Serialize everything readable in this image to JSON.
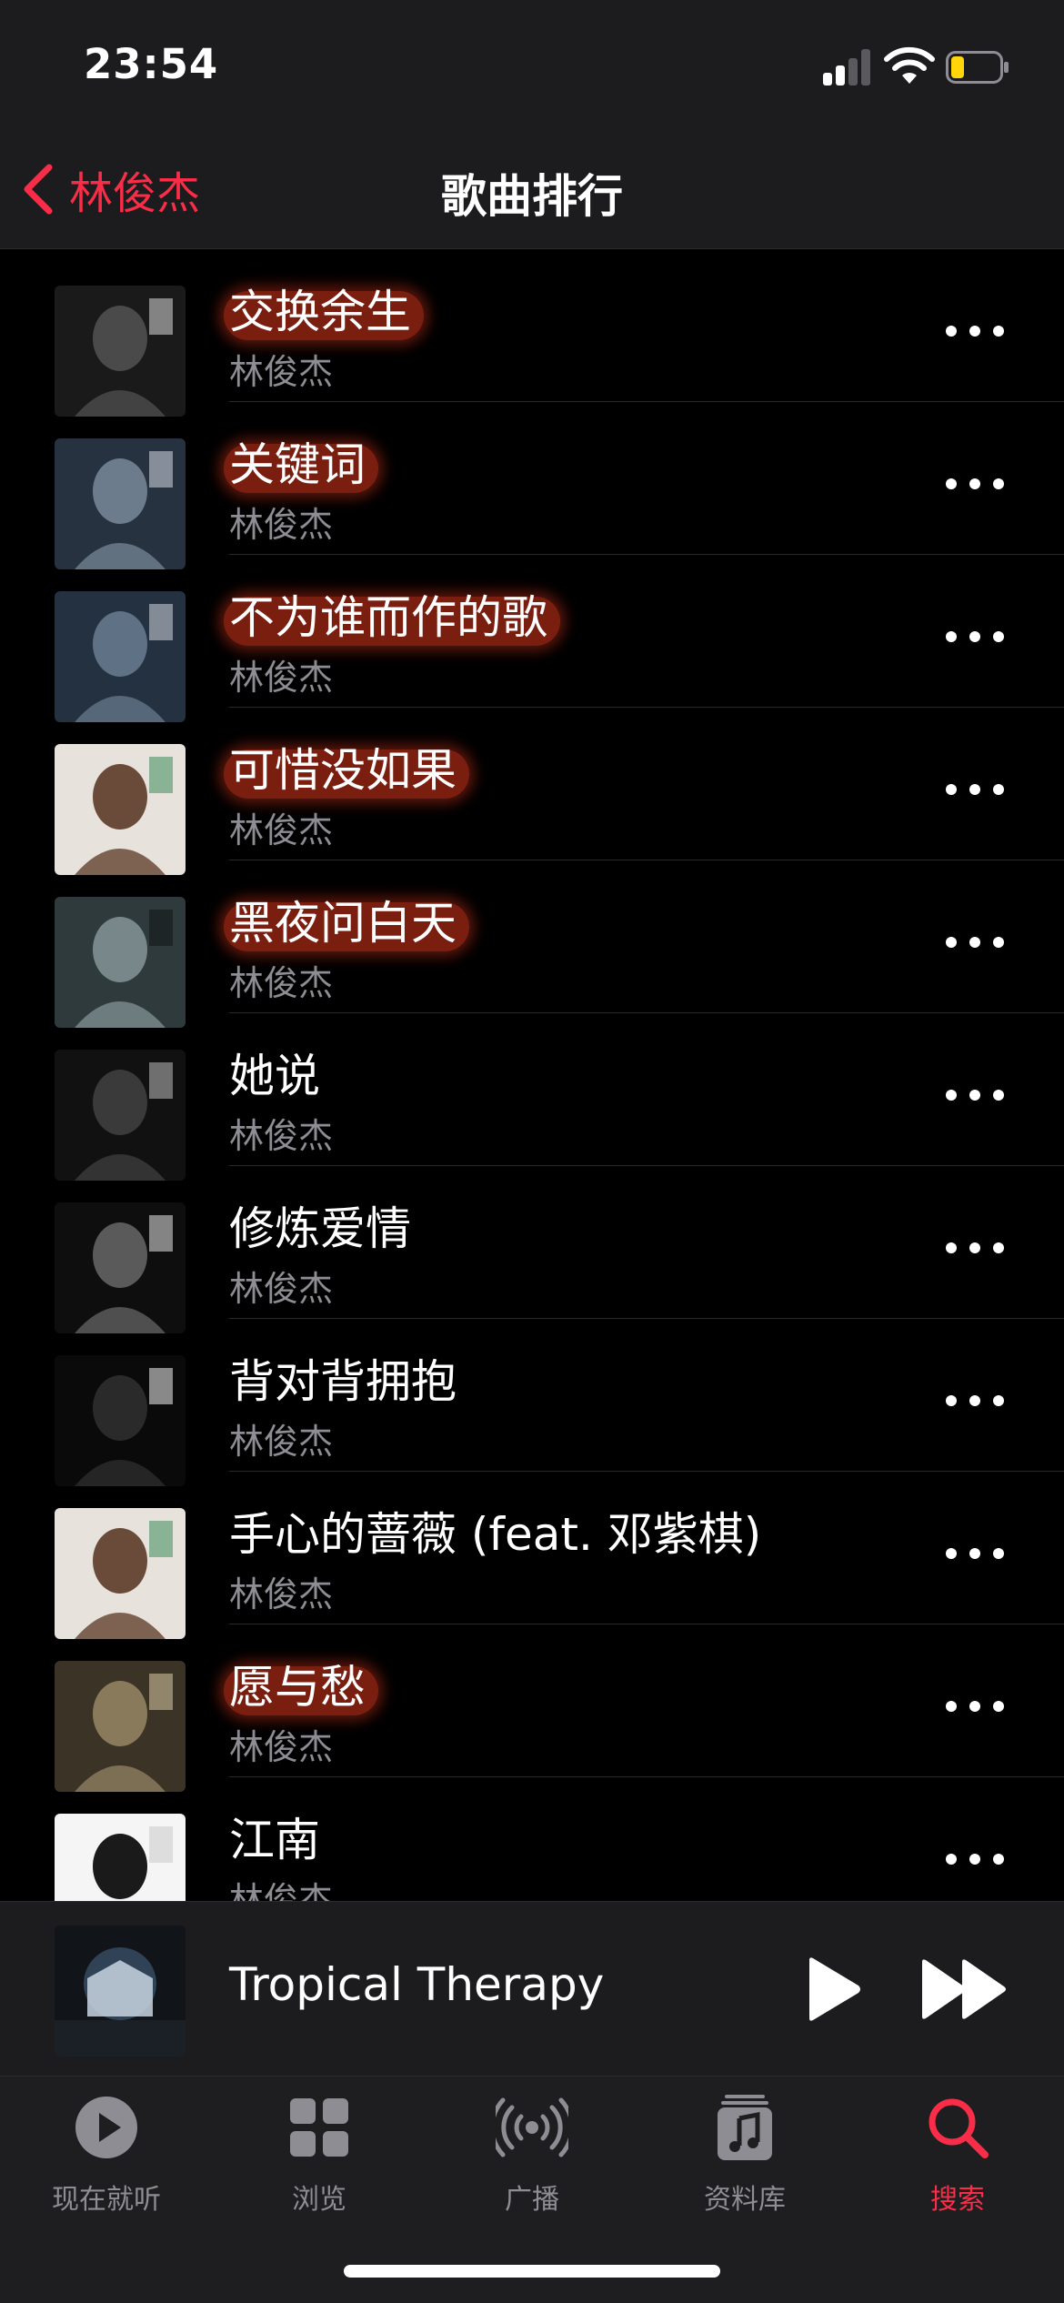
{
  "status_bar": {
    "time": "23:54"
  },
  "nav": {
    "back_label": "林俊杰",
    "title": "歌曲排行"
  },
  "songs": [
    {
      "title": "交换余生",
      "artist": "林俊杰",
      "highlighted": true,
      "art_colors": [
        "#1a1a1a",
        "#4a4a4a",
        "#dadada"
      ]
    },
    {
      "title": "关键词",
      "artist": "林俊杰",
      "highlighted": true,
      "art_colors": [
        "#26323f",
        "#6c7c8c",
        "#d6dde4"
      ]
    },
    {
      "title": "不为谁而作的歌",
      "artist": "林俊杰",
      "highlighted": true,
      "art_colors": [
        "#243140",
        "#5f7184",
        "#cfd6dd"
      ]
    },
    {
      "title": "可惜没如果",
      "artist": "林俊杰",
      "highlighted": true,
      "art_colors": [
        "#e8e2dc",
        "#6a4b3a",
        "#3c8b5a"
      ]
    },
    {
      "title": "黑夜问白天",
      "artist": "林俊杰",
      "highlighted": true,
      "art_colors": [
        "#2f3a3c",
        "#78888a",
        "#101414"
      ]
    },
    {
      "title": "她说",
      "artist": "林俊杰",
      "highlighted": false,
      "art_colors": [
        "#111111",
        "#3a3a3a",
        "#bdbdbd"
      ]
    },
    {
      "title": "修炼爱情",
      "artist": "林俊杰",
      "highlighted": false,
      "art_colors": [
        "#0e0e0e",
        "#5a5a5a",
        "#e6e6e6"
      ]
    },
    {
      "title": "背对背拥抱",
      "artist": "林俊杰",
      "highlighted": false,
      "art_colors": [
        "#0a0a0a",
        "#2a2a2a",
        "#f2f2f2"
      ]
    },
    {
      "title": "手心的蔷薇 (feat. 邓紫棋)",
      "artist": "林俊杰",
      "highlighted": false,
      "art_colors": [
        "#e8e2dc",
        "#6a4b3a",
        "#3c8b5a"
      ]
    },
    {
      "title": "愿与愁",
      "artist": "林俊杰",
      "highlighted": true,
      "art_colors": [
        "#3a3326",
        "#8a7a5c",
        "#d8c9a4"
      ]
    },
    {
      "title": "江南",
      "artist": "林俊杰",
      "highlighted": false,
      "art_colors": [
        "#f5f5f5",
        "#1a1a1a",
        "#c8c8c8"
      ]
    }
  ],
  "mini_player": {
    "title": "Tropical Therapy",
    "art_colors": [
      "#111418",
      "#4a6a8a",
      "#c8d4e0"
    ]
  },
  "tabs": [
    {
      "label": "现在就听",
      "icon": "play-circle-icon",
      "active": false
    },
    {
      "label": "浏览",
      "icon": "grid-icon",
      "active": false
    },
    {
      "label": "广播",
      "icon": "radio-icon",
      "active": false
    },
    {
      "label": "资料库",
      "icon": "music-library-icon",
      "active": false
    },
    {
      "label": "搜索",
      "icon": "search-icon",
      "active": true
    }
  ],
  "colors": {
    "accent": "#fa2d48",
    "highlight": "#7a1e10",
    "secondary_text": "#8d8d93",
    "battery_low": "#ffd60a"
  }
}
